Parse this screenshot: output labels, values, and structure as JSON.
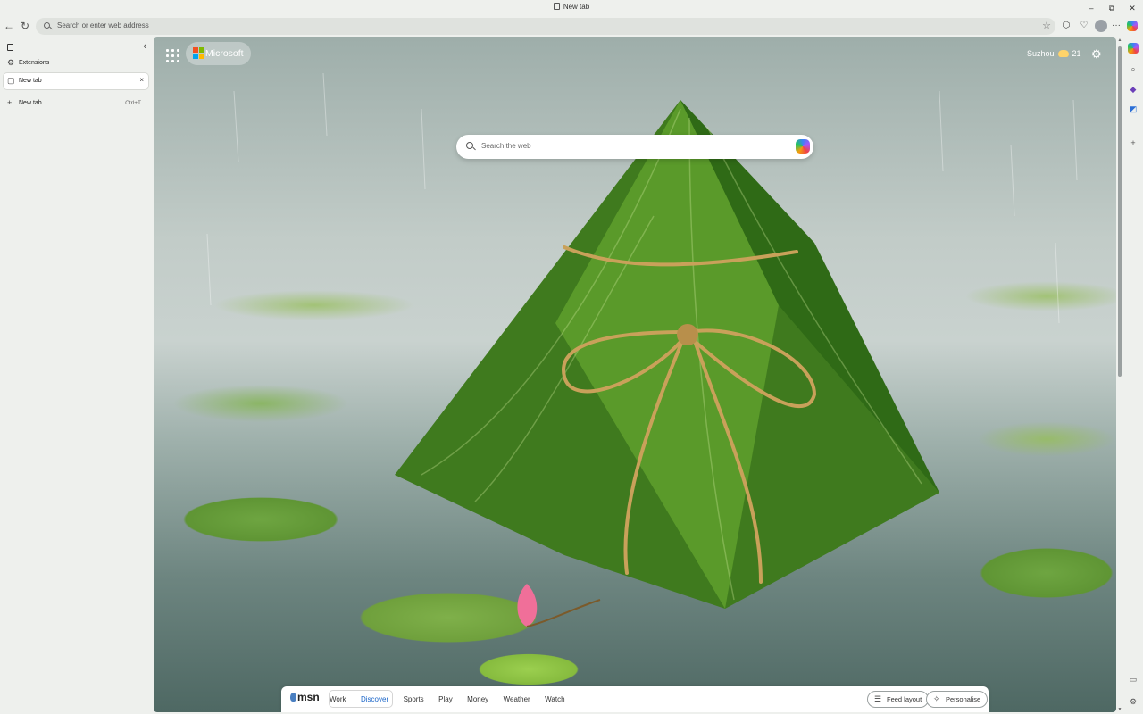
{
  "window": {
    "title": "New tab",
    "controls": {
      "minimize": "–",
      "maximize": "⧉",
      "close": "✕"
    }
  },
  "toolbar": {
    "back_icon": "back-arrow-icon",
    "refresh_icon": "refresh-icon",
    "address_placeholder": "Search or enter web address",
    "favorite_icon": "star-icon",
    "extensions_icon": "puzzle-icon",
    "more_label": "···"
  },
  "vertical_tabs": {
    "items": [
      {
        "label": "Extensions",
        "icon": "puzzle-icon"
      },
      {
        "label": "New tab",
        "icon": "tab-page-icon",
        "active": true
      },
      {
        "label": "New tab",
        "icon": "plus-icon",
        "shortcut": "Ctrl+T"
      }
    ]
  },
  "newtab": {
    "brand": "Microsoft",
    "search_placeholder": "Search the web",
    "weather": {
      "city": "Suzhou",
      "temp": "21"
    },
    "ms_colors": [
      "#f25022",
      "#7fba00",
      "#00a4ef",
      "#ffb900"
    ]
  },
  "feed": {
    "brand": "msn",
    "tabs": [
      "Work",
      "Discover",
      "Sports",
      "Play",
      "Money",
      "Weather",
      "Watch"
    ],
    "selected_tab": "Discover",
    "layout_button": "Feed layout",
    "personalise_button": "Personalise"
  }
}
